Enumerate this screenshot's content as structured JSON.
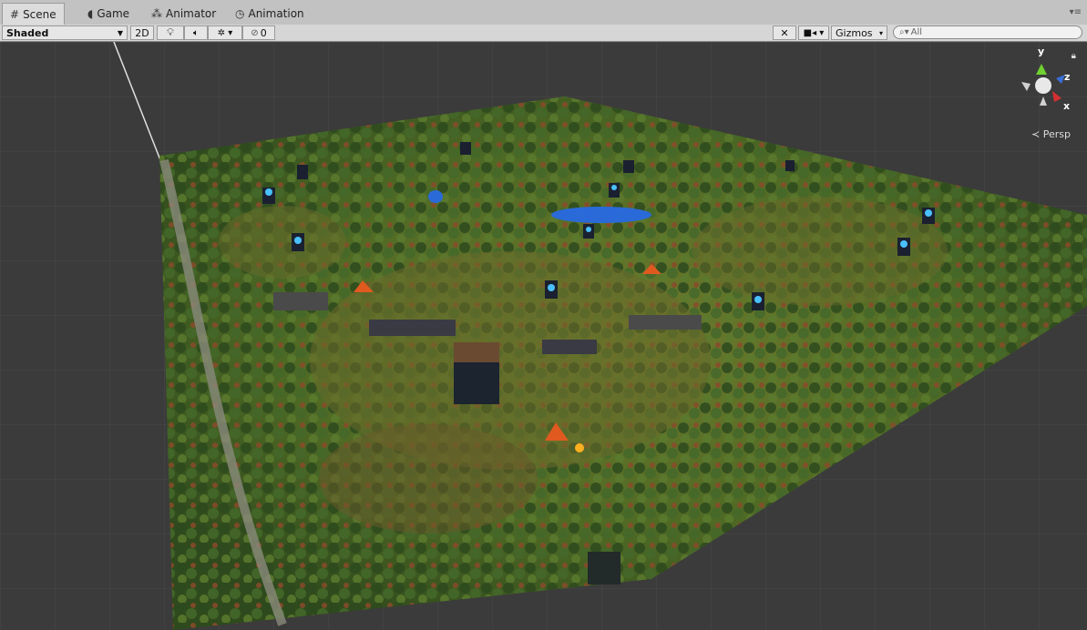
{
  "tabs": [
    {
      "label": "Scene",
      "icon": "grid-icon"
    },
    {
      "label": "Game",
      "icon": "pacman-icon"
    },
    {
      "label": "Animator",
      "icon": "animator-icon"
    },
    {
      "label": "Animation",
      "icon": "clock-icon"
    }
  ],
  "toolbar": {
    "draw_mode": "Shaded",
    "mode_2d": "2D",
    "hidden_count": "0",
    "gizmos_label": "Gizmos",
    "search_placeholder": "All"
  },
  "scene_gizmo": {
    "x_label": "x",
    "y_label": "y",
    "z_label": "z",
    "projection_label": "Persp",
    "colors": {
      "x": "#d43030",
      "y": "#6fd030",
      "z": "#3a6fd8"
    }
  }
}
